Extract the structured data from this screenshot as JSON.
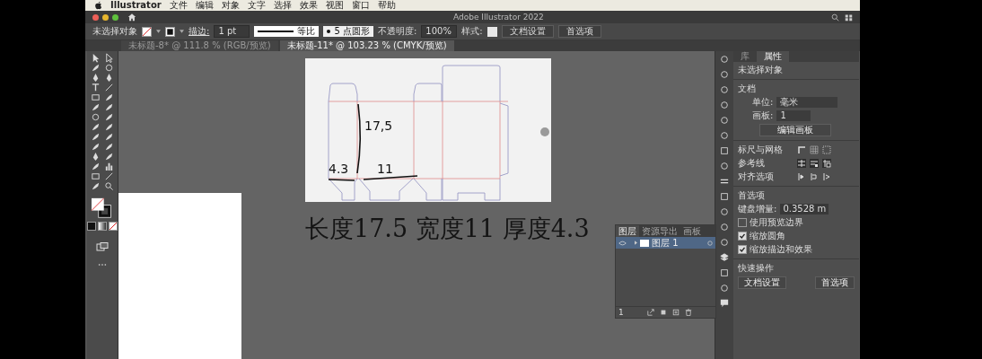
{
  "menu_bar": {
    "app": "Illustrator",
    "items": [
      "文件",
      "编辑",
      "对象",
      "文字",
      "选择",
      "效果",
      "视图",
      "窗口",
      "帮助"
    ]
  },
  "window": {
    "title": "Adobe Illustrator 2022"
  },
  "control_bar": {
    "selection": "未选择对象",
    "stroke_label": "描边:",
    "stroke_weight": "1 pt",
    "stroke_profile": "等比",
    "brush": "5 点圆形",
    "opacity_label": "不透明度:",
    "opacity": "100%",
    "style_label": "样式:",
    "buttons": [
      "文档设置",
      "首选项"
    ]
  },
  "document_tabs": [
    {
      "label": "未标题-8* @ 111.8 % (RGB/预览)",
      "selected": false
    },
    {
      "label": "未标题-11* @ 103.23 % (CMYK/预览)",
      "selected": true
    }
  ],
  "artboard": {
    "notes": [
      "17,5",
      "4.3",
      "11"
    ]
  },
  "caption": "长度17.5 宽度11 厚度4.3",
  "layers_panel": {
    "tabs": [
      {
        "label": "图层",
        "selected": true
      },
      {
        "label": "资源导出",
        "selected": false
      },
      {
        "label": "画板",
        "selected": false
      }
    ],
    "layers": [
      {
        "name": "图层 1",
        "visible": true,
        "selected": true
      }
    ],
    "count": "1"
  },
  "properties_panel": {
    "tabs": [
      {
        "label": "库",
        "selected": false
      },
      {
        "label": "属性",
        "selected": true
      }
    ],
    "selection": "未选择对象",
    "document_heading": "文档",
    "unit_label": "单位:",
    "unit": "毫米",
    "artboard_label": "画板:",
    "artboard": "1",
    "edit_artboards": "编辑画板",
    "rulers_grids": "标尺与网格",
    "guides": "参考线",
    "align_options": "对齐选项",
    "preferences_heading": "首选项",
    "key_increment_label": "键盘增量:",
    "key_increment": "0.3528 m",
    "options": [
      {
        "label": "使用预览边界",
        "checked": false
      },
      {
        "label": "缩放圆角",
        "checked": true
      },
      {
        "label": "缩放描边和效果",
        "checked": true
      }
    ],
    "quick_actions_heading": "快速操作",
    "quick_actions": [
      "文档设置",
      "首选项"
    ]
  }
}
